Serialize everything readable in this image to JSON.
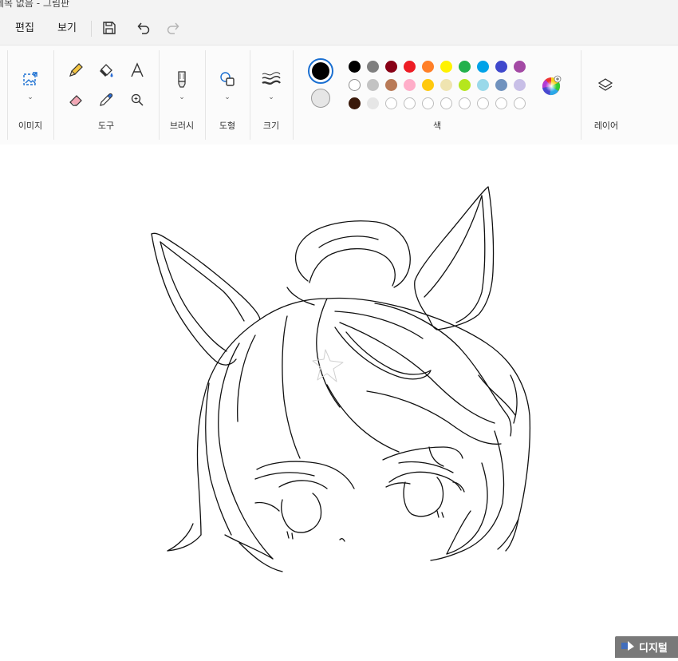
{
  "window": {
    "title": "제목 없음 - 그림판"
  },
  "menu": {
    "edit": "편집",
    "view": "보기"
  },
  "quick_access": [
    "save-icon",
    "undo-icon",
    "redo-icon"
  ],
  "ribbon": {
    "groups": {
      "image": "이미지",
      "tools": "도구",
      "brushes": "브러시",
      "shapes": "도형",
      "size": "크기",
      "colors": "색",
      "layers": "레이어"
    },
    "tools": [
      "pencil-icon",
      "fill-icon",
      "text-icon",
      "eraser-icon",
      "color-picker-icon",
      "magnifier-icon"
    ]
  },
  "colors": {
    "primary": "#000000",
    "secondary": "#e6e6e6",
    "palette_row1": [
      "#000000",
      "#7f7f7f",
      "#880015",
      "#ed1c24",
      "#ff7f27",
      "#fff200",
      "#22b14c",
      "#00a2e8",
      "#3f48cc",
      "#a349a4"
    ],
    "palette_row2": [
      "#ffffff",
      "#c3c3c3",
      "#b97a57",
      "#ffaec9",
      "#ffc90e",
      "#efe4b0",
      "#b5e61d",
      "#99d9ea",
      "#7092be",
      "#c8bfe7"
    ],
    "palette_row3": [
      "#3b1a0b",
      "#e6e6e6",
      "empty",
      "empty",
      "empty",
      "empty",
      "empty",
      "empty",
      "empty",
      "empty"
    ]
  },
  "watermark": {
    "text": "디지털"
  }
}
